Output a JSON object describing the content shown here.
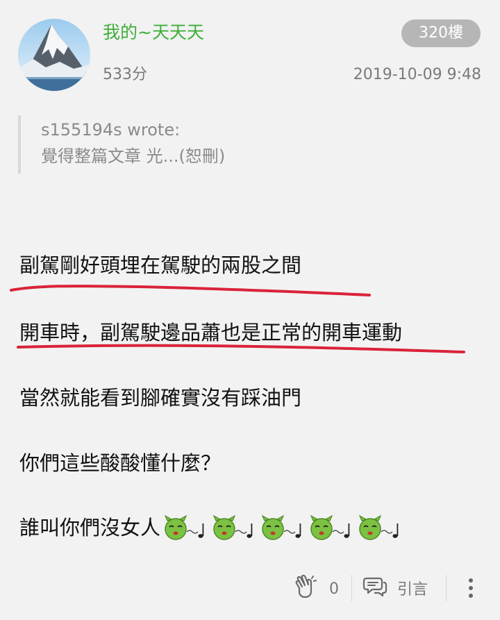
{
  "post": {
    "username": "我的~天天天",
    "score": "533分",
    "floor": "320樓",
    "timestamp": "2019-10-09 9:48"
  },
  "quote": {
    "author": "s155194s wrote:",
    "text": "覺得整篇文章 光...(恕刪)"
  },
  "body": {
    "line1": "副駕剛好頭埋在駕駛的兩股之間",
    "line2": "開車時，副駕駛邊品蕭也是正常的開車運動",
    "line3": "當然就能看到腳確實沒有踩油門",
    "line4": "你們這些酸酸懂什麼？",
    "line5": "誰叫你們沒女人",
    "emote_name": "green-kiss-emoticon",
    "emote_count": 5
  },
  "actions": {
    "like_count": "0",
    "quote_label": "引言"
  },
  "colors": {
    "username": "#3fae3b",
    "underline": "#d9233a",
    "badge": "#b6b6b6",
    "background": "#f2f2f2"
  },
  "icons": {
    "like": "clap-hands-icon",
    "quote": "speech-bubble-icon",
    "more": "more-vertical-icon"
  }
}
